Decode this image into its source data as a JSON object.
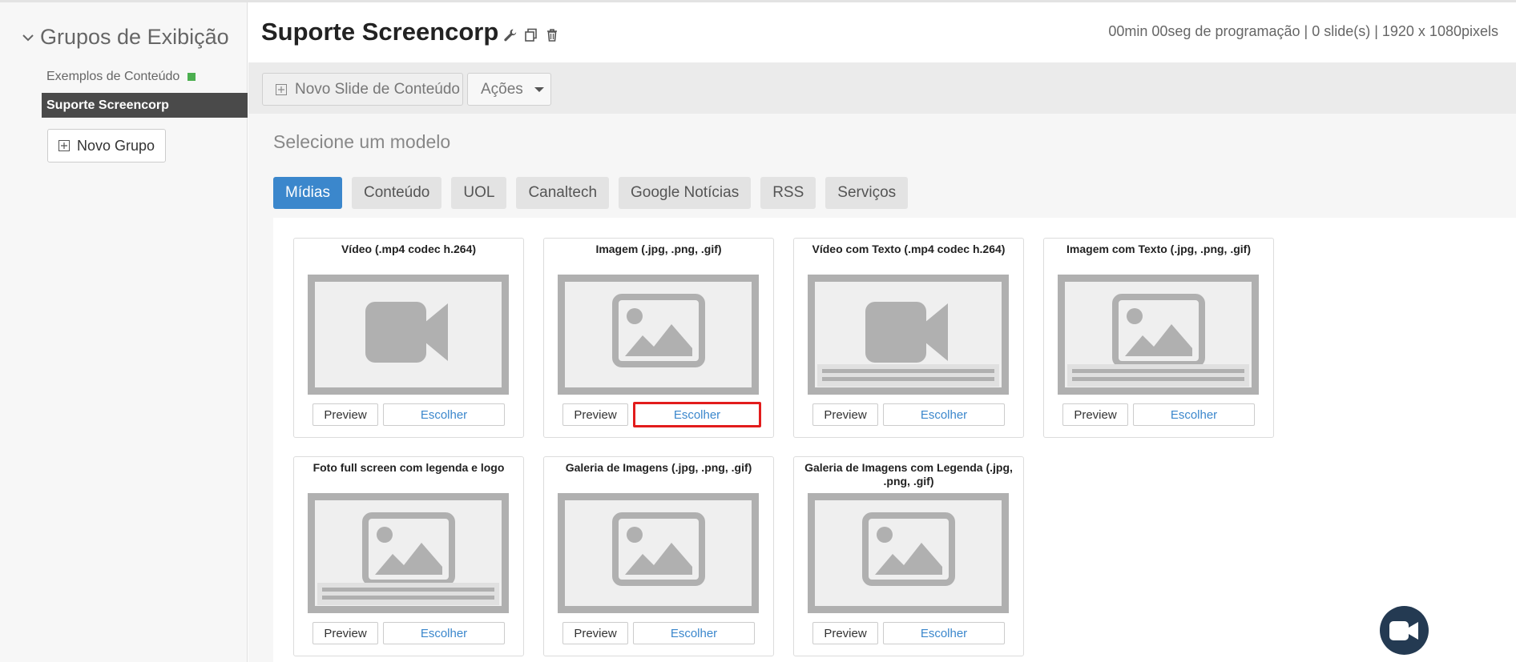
{
  "sidebar": {
    "heading": "Grupos de Exibição",
    "groups": [
      {
        "label": "Exemplos de Conteúdo",
        "status_color": "#4caf50"
      },
      {
        "label": "Suporte Screencorp"
      }
    ],
    "new_group_label": "Novo Grupo"
  },
  "header": {
    "title": "Suporte Screencorp",
    "info": "00min 00seg de programação | 0 slide(s) | 1920 x 1080pixels"
  },
  "toolbar": {
    "new_slide_label": "Novo Slide de Conteúdo",
    "actions_label": "Ações"
  },
  "main": {
    "section_title": "Selecione um modelo",
    "tabs": [
      "Mídias",
      "Conteúdo",
      "UOL",
      "Canaltech",
      "Google Notícias",
      "RSS",
      "Serviços"
    ],
    "active_tab": "Mídias",
    "cards": [
      {
        "title": "Vídeo (.mp4 codec h.264)",
        "icon": "video-camera-icon",
        "preview_label": "Preview",
        "choose_label": "Escolher"
      },
      {
        "title": "Imagem (.jpg, .png, .gif)",
        "icon": "image-icon",
        "preview_label": "Preview",
        "choose_label": "Escolher",
        "highlighted": true
      },
      {
        "title": "Vídeo com Texto (.mp4 codec h.264)",
        "icon": "video-camera-icon",
        "preview_label": "Preview",
        "choose_label": "Escolher"
      },
      {
        "title": "Imagem com Texto (.jpg, .png, .gif)",
        "icon": "image-icon",
        "preview_label": "Preview",
        "choose_label": "Escolher"
      },
      {
        "title": "Foto full screen com legenda e logo",
        "icon": "image-icon",
        "preview_label": "Preview",
        "choose_label": "Escolher"
      },
      {
        "title": "Galeria de Imagens (.jpg, .png, .gif)",
        "icon": "image-icon",
        "preview_label": "Preview",
        "choose_label": "Escolher"
      },
      {
        "title": "Galeria de Imagens com Legenda (.jpg, .png, .gif)",
        "icon": "image-icon",
        "preview_label": "Preview",
        "choose_label": "Escolher"
      }
    ]
  },
  "colors": {
    "accent": "#3b87cc",
    "highlight": "#e21c1c",
    "active_group_bg": "#4a4a4a",
    "fab_bg": "#243a52"
  }
}
